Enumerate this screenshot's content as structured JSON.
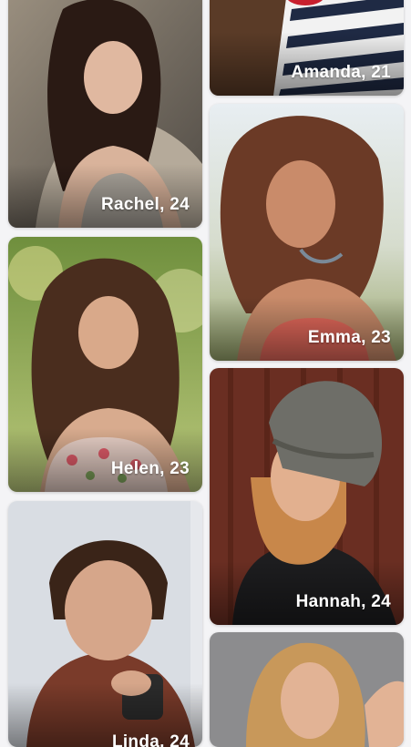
{
  "profiles": [
    {
      "name": "Rachel, 24"
    },
    {
      "name": "Helen, 23"
    },
    {
      "name": "Linda, 24"
    },
    {
      "name": "Amanda, 21"
    },
    {
      "name": "Emma, 23"
    },
    {
      "name": "Hannah, 24"
    },
    {
      "name": ""
    }
  ]
}
